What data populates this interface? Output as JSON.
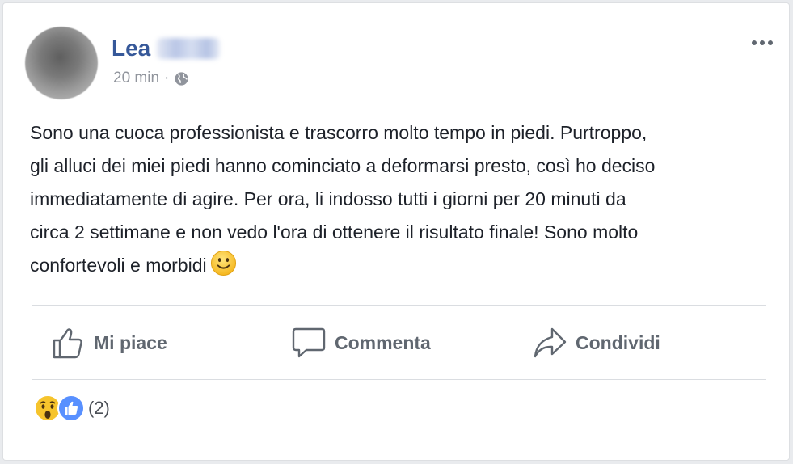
{
  "post": {
    "author": "Lea",
    "time": "20 min",
    "separator": "·",
    "privacy_icon": "globe-icon",
    "text": "Sono una cuoca professionista e trascorro molto tempo in piedi. Purtroppo,\ngli alluci dei miei piedi hanno cominciato a deformarsi presto, così ho deciso\nimmediatamente di agire. Per ora, li indosso tutti i giorni per 20 minuti da\ncirca 2 settimane e non vedo l'ora di ottenere il risultato finale! Sono molto\nconfortevoli e morbidi",
    "emoji": "smile-icon"
  },
  "actions": {
    "like": "Mi piace",
    "comment": "Commenta",
    "share": "Condividi"
  },
  "reactions": {
    "icons": [
      "wow-icon",
      "like-icon"
    ],
    "count": "(2)"
  },
  "colors": {
    "name": "#365899",
    "meta": "#90949c",
    "action": "#606770",
    "text": "#1d2129"
  }
}
